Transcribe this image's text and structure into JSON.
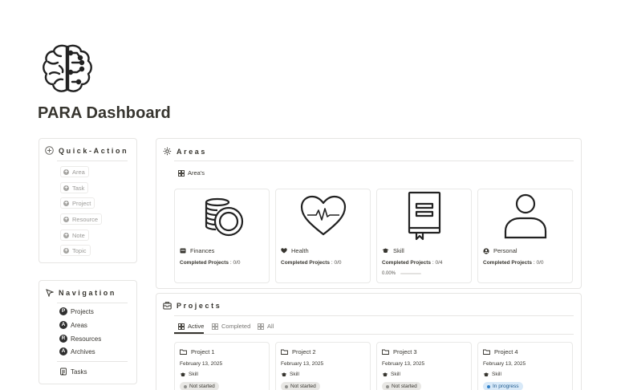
{
  "page": {
    "title": "PARA Dashboard"
  },
  "quick_action": {
    "title": "Quick-Action",
    "items": [
      "Area",
      "Task",
      "Project",
      "Resource",
      "Note",
      "Topic"
    ]
  },
  "navigation": {
    "title": "Navigation",
    "items": [
      {
        "badge": "P",
        "label": "Projects"
      },
      {
        "badge": "A",
        "label": "Areas"
      },
      {
        "badge": "R",
        "label": "Resources"
      },
      {
        "badge": "A",
        "label": "Archives"
      }
    ],
    "tasks_label": "Tasks"
  },
  "areas": {
    "title": "Areas",
    "view_label": "Area's",
    "completed_label": "Completed Projects",
    "cards": [
      {
        "name": "Finances",
        "icon": "coins-icon",
        "completed": "0/0"
      },
      {
        "name": "Health",
        "icon": "heartbeat-icon",
        "completed": "0/0"
      },
      {
        "name": "Skill",
        "icon": "book-icon",
        "completed": "0/4",
        "progress": "0.00%"
      },
      {
        "name": "Personal",
        "icon": "person-icon",
        "completed": "0/0"
      }
    ]
  },
  "projects": {
    "title": "Projects",
    "tabs": [
      "Active",
      "Completed",
      "All"
    ],
    "cards": [
      {
        "name": "Project 1",
        "date": "February 13, 2025",
        "area": "Skill",
        "status": "Not started"
      },
      {
        "name": "Project 2",
        "date": "February 13, 2025",
        "area": "Skill",
        "status": "Not started"
      },
      {
        "name": "Project 3",
        "date": "February 13, 2025",
        "area": "Skill",
        "status": "Not started"
      },
      {
        "name": "Project 4",
        "date": "February 13, 2025",
        "area": "Skill",
        "status": "In progress"
      }
    ]
  },
  "colors": {
    "text": "#37352f",
    "muted": "#9b9a97",
    "border": "#e6e5e3",
    "not_started_bg": "#e8e7e4",
    "not_started_dot": "#91918e",
    "in_progress_bg": "#d8e9f8",
    "in_progress_text": "#1f5b8f",
    "in_progress_dot": "#2f80c8"
  }
}
